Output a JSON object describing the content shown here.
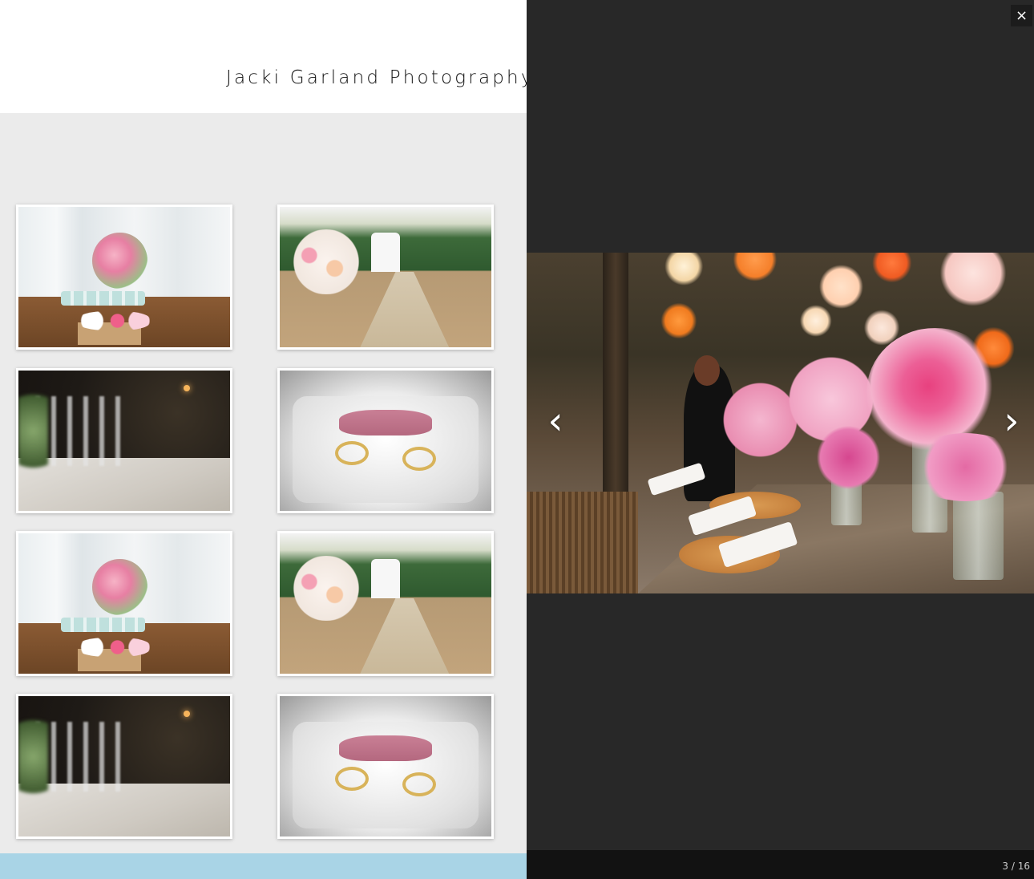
{
  "site": {
    "title": "Jacki Garland Photography"
  },
  "gallery": {
    "thumbnails": [
      {
        "name": "thumbnail-sweet-table",
        "scene": "table"
      },
      {
        "name": "thumbnail-ceremony-aisle",
        "scene": "aisle"
      },
      {
        "name": "thumbnail-dinner-table",
        "scene": "dinner"
      },
      {
        "name": "thumbnail-wedding-rings",
        "scene": "rings"
      },
      {
        "name": "thumbnail-sweet-table",
        "scene": "table"
      },
      {
        "name": "thumbnail-ceremony-aisle",
        "scene": "aisle"
      },
      {
        "name": "thumbnail-dinner-table",
        "scene": "dinner"
      },
      {
        "name": "thumbnail-wedding-rings",
        "scene": "rings"
      }
    ]
  },
  "lightbox": {
    "close_icon": "×",
    "prev_icon": "‹",
    "next_icon": "›",
    "counter": "3 / 16"
  },
  "colors": {
    "lightbox_bg": "#282828",
    "page_bg": "#ebebeb",
    "footer_band": "#a9d4e6"
  }
}
